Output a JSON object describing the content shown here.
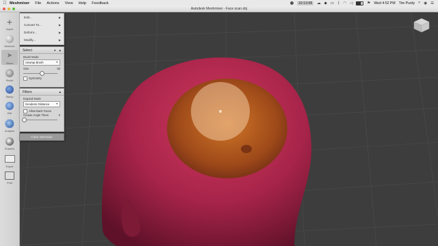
{
  "menubar": {
    "apple_icon": "apple-icon",
    "app_name": "Meshmixer",
    "items": [
      "File",
      "Actions",
      "View",
      "Help",
      "Feedback"
    ],
    "right": {
      "clock_readout": "10:13:08",
      "day_time": "Wed 4:52 PM",
      "user": "Tim Purdy"
    }
  },
  "window": {
    "title": "Autodesk Meshmixer - Face scan.obj"
  },
  "toolbar": {
    "tools": [
      {
        "label": "Import",
        "icon": "plus-icon"
      },
      {
        "label": "Meshmix",
        "icon": "sphere-icon"
      },
      {
        "label": "Select",
        "icon": "arrow-select-icon"
      },
      {
        "label": "Sculpt",
        "icon": "brush-icon"
      },
      {
        "label": "Stamp",
        "icon": "stamp-icon"
      },
      {
        "label": "Edit",
        "icon": "edit-icon"
      },
      {
        "label": "Analysis",
        "icon": "analysis-icon"
      },
      {
        "label": "Shaders",
        "icon": "shader-icon"
      },
      {
        "label": "Export",
        "icon": "export-icon"
      },
      {
        "label": "Print",
        "icon": "print-icon"
      }
    ],
    "active_index": 2
  },
  "edit_menu": {
    "items": [
      "Edit...",
      "Convert To...",
      "Deform...",
      "Modify..."
    ]
  },
  "select_panel": {
    "title": "Select",
    "brush_mode_label": "Brush Mode",
    "brush_mode_value": "Unwrap Brush",
    "size_label": "Size",
    "size_value": "50",
    "size_fraction": 0.5,
    "symmetry_label": "Symmetry"
  },
  "filters_panel": {
    "title": "Filters",
    "expand_mode_label": "Expand Mode",
    "expand_mode_value": "Geodesic Distance",
    "allow_back_faces_label": "Allow Back Faces",
    "crease_angle_label": "Crease Angle Thres",
    "crease_angle_value": "0",
    "crease_angle_fraction": 0.02
  },
  "clear_selection_label": "Clear Selection",
  "colors": {
    "mesh": "#b3294a",
    "selection": "#c0621a",
    "brush": "#f0c9a0",
    "grid": "#555555",
    "background": "#3d3d3d"
  }
}
